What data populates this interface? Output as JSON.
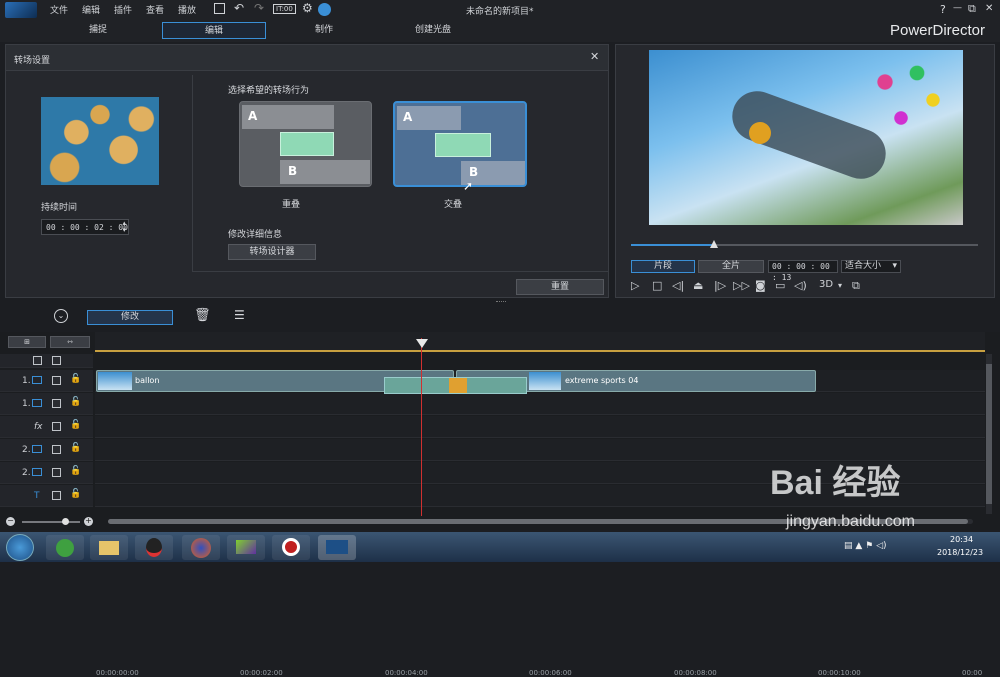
{
  "menu": {
    "file": "文件",
    "edit": "编辑",
    "plugins": "插件",
    "view": "查看",
    "play": "播放",
    "timecode_icon": "IT:00",
    "title": "未命名的新项目*"
  },
  "window_controls": {
    "help": "?",
    "minimize": "—",
    "restore": "⧉",
    "close": "✕"
  },
  "modes": {
    "capture": "捕捉",
    "edit": "编辑",
    "produce": "制作",
    "create_disc": "创建光盘",
    "brand": "PowerDirector"
  },
  "transition": {
    "header": "转场设置",
    "close": "✕",
    "duration_label": "持续时间",
    "duration_value": "00 : 00 : 02 : 00",
    "behavior_label": "选择希望的转场行为",
    "options": [
      {
        "label": "重叠",
        "a": "A",
        "b": "B"
      },
      {
        "label": "交叠",
        "a": "A",
        "b": "B"
      }
    ],
    "details_label": "修改详细信息",
    "designer_button": "转场设计器",
    "reset_button": "重置"
  },
  "preview": {
    "clip_tab": "片段",
    "movie_tab": "全片",
    "timecode": "00 : 00 : 00 : 13",
    "fit": "适合大小",
    "three_d": "3D",
    "progress": 0.24
  },
  "toolbar": {
    "modify_button": "修改"
  },
  "ruler": [
    "00:00:00:00",
    "00:00:02:00",
    "00:00:04:00",
    "00:00:06:00",
    "00:00:08:00",
    "00:00:10:00",
    "00:00"
  ],
  "tracks": [
    {
      "label": "1.",
      "type": "video"
    },
    {
      "label": "1.",
      "type": "audio"
    },
    {
      "label": "fx",
      "type": "fx"
    },
    {
      "label": "2.",
      "type": "video"
    },
    {
      "label": "2.",
      "type": "audio"
    },
    {
      "label": "T",
      "type": "title"
    }
  ],
  "clips": {
    "clip1": "ballon",
    "clip2": "extreme sports 04"
  },
  "taskbar": {
    "time": "20:34",
    "date": "2018/12/23"
  },
  "watermark": {
    "brand": "Bai 经验",
    "url": "jingyan.baidu.com"
  },
  "colors": {
    "accent": "#3a8fd6",
    "playhead": "#d03030"
  }
}
